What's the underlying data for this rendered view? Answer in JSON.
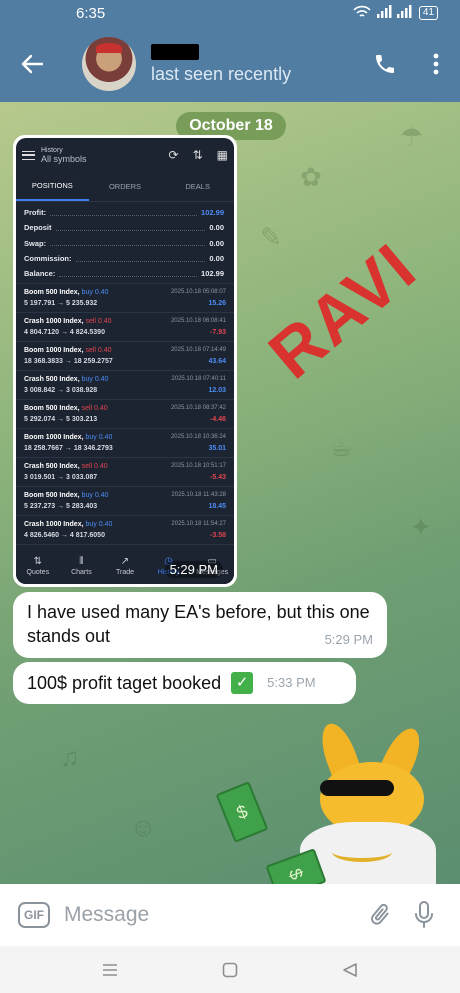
{
  "status": {
    "time": "6:35",
    "battery": "41"
  },
  "header": {
    "last_seen": "last seen recently"
  },
  "chat": {
    "date": "October 18",
    "photo_time": "5:29 PM",
    "watermark": "RAVI",
    "messages": [
      {
        "text": "I have used many EA's before, but this one stands out",
        "time": "5:29 PM"
      },
      {
        "text": "100$ profit taget booked",
        "time": "5:33 PM"
      }
    ]
  },
  "mt5": {
    "title": "History",
    "subtitle": "All symbols",
    "tabs": [
      "POSITIONS",
      "ORDERS",
      "DEALS"
    ],
    "summary": [
      {
        "label": "Profit:",
        "value": "102.99"
      },
      {
        "label": "Deposit",
        "value": "0.00"
      },
      {
        "label": "Swap:",
        "value": "0.00"
      },
      {
        "label": "Commission:",
        "value": "0.00"
      },
      {
        "label": "Balance:",
        "value": "102.99"
      }
    ],
    "trades": [
      {
        "symbol": "Boom 500 Index,",
        "dir": "buy 0.40",
        "time": "2025.10.18 05:08:07",
        "prices": "5 197.791 → 5 235.932",
        "profit": "15.26"
      },
      {
        "symbol": "Crash 1000 Index,",
        "dir": "sell 0.40",
        "time": "2025.10.18 06:08:41",
        "prices": "4 804.7120 → 4 824.5390",
        "profit": "-7.93"
      },
      {
        "symbol": "Boom 1000 Index,",
        "dir": "sell 0.40",
        "time": "2025.10.18 07:14:49",
        "prices": "18 368.3833 → 18 259.2757",
        "profit": "43.64"
      },
      {
        "symbol": "Crash 500 Index,",
        "dir": "buy 0.40",
        "time": "2025.10.18 07:40:11",
        "prices": "3 008.842 → 3 038.928",
        "profit": "12.03"
      },
      {
        "symbol": "Boom 500 Index,",
        "dir": "sell 0.40",
        "time": "2025.10.18 08:37:42",
        "prices": "5 292.074 → 5 303.213",
        "profit": "-4.46"
      },
      {
        "symbol": "Boom 1000 Index,",
        "dir": "buy 0.40",
        "time": "2025.10.18 10:36:24",
        "prices": "18 258.7667 → 18 346.2793",
        "profit": "35.01"
      },
      {
        "symbol": "Crash 500 Index,",
        "dir": "sell 0.40",
        "time": "2025.10.18 10:51:17",
        "prices": "3 019.501 → 3 033.087",
        "profit": "-5.43"
      },
      {
        "symbol": "Boom 500 Index,",
        "dir": "buy 0.40",
        "time": "2025.10.18 11:43:28",
        "prices": "5 237.273 → 5 283.403",
        "profit": "18.45"
      },
      {
        "symbol": "Crash 1000 Index,",
        "dir": "buy 0.40",
        "time": "2025.10.18 11:54:27",
        "prices": "4 826.5460 → 4 817.6050",
        "profit": "-3.58"
      }
    ],
    "nav": [
      "Quotes",
      "Charts",
      "Trade",
      "History",
      "Messages"
    ]
  },
  "input": {
    "gif_label": "GIF",
    "placeholder": "Message"
  },
  "colors": {
    "header": "#517da2",
    "buy": "#4d8df5",
    "sell": "#e0464e",
    "watermark": "#d8332e"
  },
  "icons": [
    "wifi-icon",
    "signal-icon",
    "battery-icon",
    "back-arrow-icon",
    "phone-icon",
    "more-icon",
    "paperclip-icon",
    "microphone-icon",
    "recents-icon",
    "home-icon",
    "back-icon"
  ]
}
